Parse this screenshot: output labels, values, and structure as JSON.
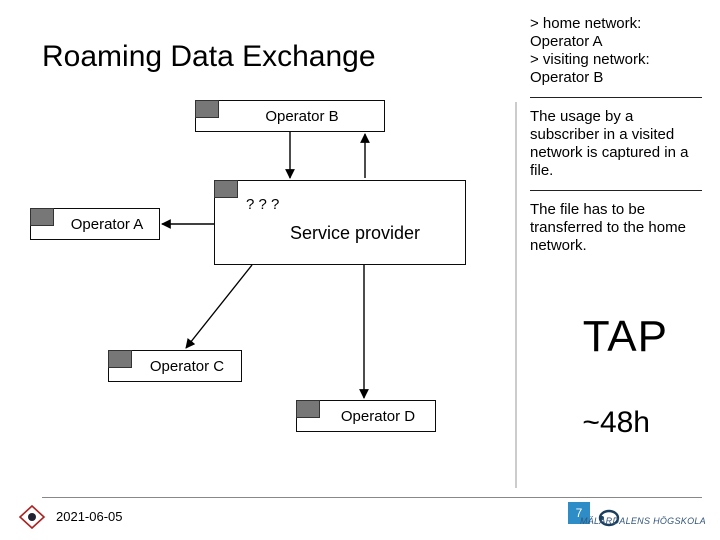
{
  "title": "Roaming Data Exchange",
  "side": {
    "note1": "> home network: Operator A\n> visiting network: Operator B",
    "note2": "The usage by a subscriber in a visited network is captured in a file.",
    "note3": "The file has to be transferred to the home network."
  },
  "diagram": {
    "operator_b": "Operator B",
    "operator_a": "Operator A",
    "service_provider": "Service provider",
    "operator_c": "Operator C",
    "operator_d": "Operator D",
    "qmark": "? ? ?"
  },
  "tap_label": "TAP",
  "time_label": "~48h",
  "footer": {
    "date": "2021-06-05",
    "page": "7",
    "uni": "MÄLARDALENS HÖGSKOLA"
  }
}
